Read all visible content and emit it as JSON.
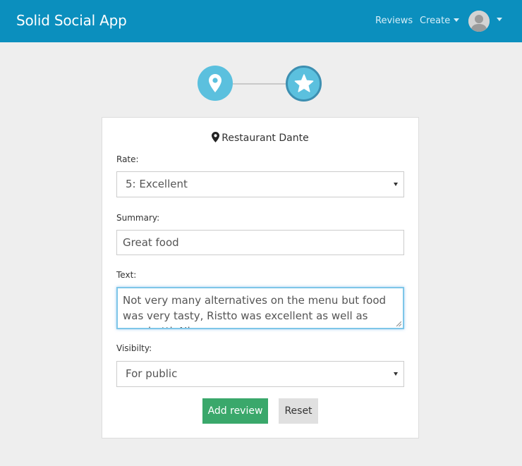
{
  "navbar": {
    "brand": "Solid Social App",
    "reviews_label": "Reviews",
    "create_label": "Create"
  },
  "form": {
    "place_name": "Restaurant Dante",
    "rate_label": "Rate:",
    "rate_value": "5: Excellent",
    "summary_label": "Summary:",
    "summary_value": "Great food",
    "text_label": "Text:",
    "text_value": "Not very many alternatives on the menu but food was very tasty, Ristto was excellent as well as spaghetti. Nice",
    "visibility_label": "Visibilty:",
    "visibility_value": "For public",
    "add_button": "Add review",
    "reset_button": "Reset"
  },
  "steps": {
    "step1_icon": "map-marker-icon",
    "step2_icon": "star-icon"
  },
  "colors": {
    "navbar": "#0b8fbe",
    "step": "#5bc0de",
    "add_button": "#3aa86b",
    "reset_button": "#e0e0e0"
  }
}
